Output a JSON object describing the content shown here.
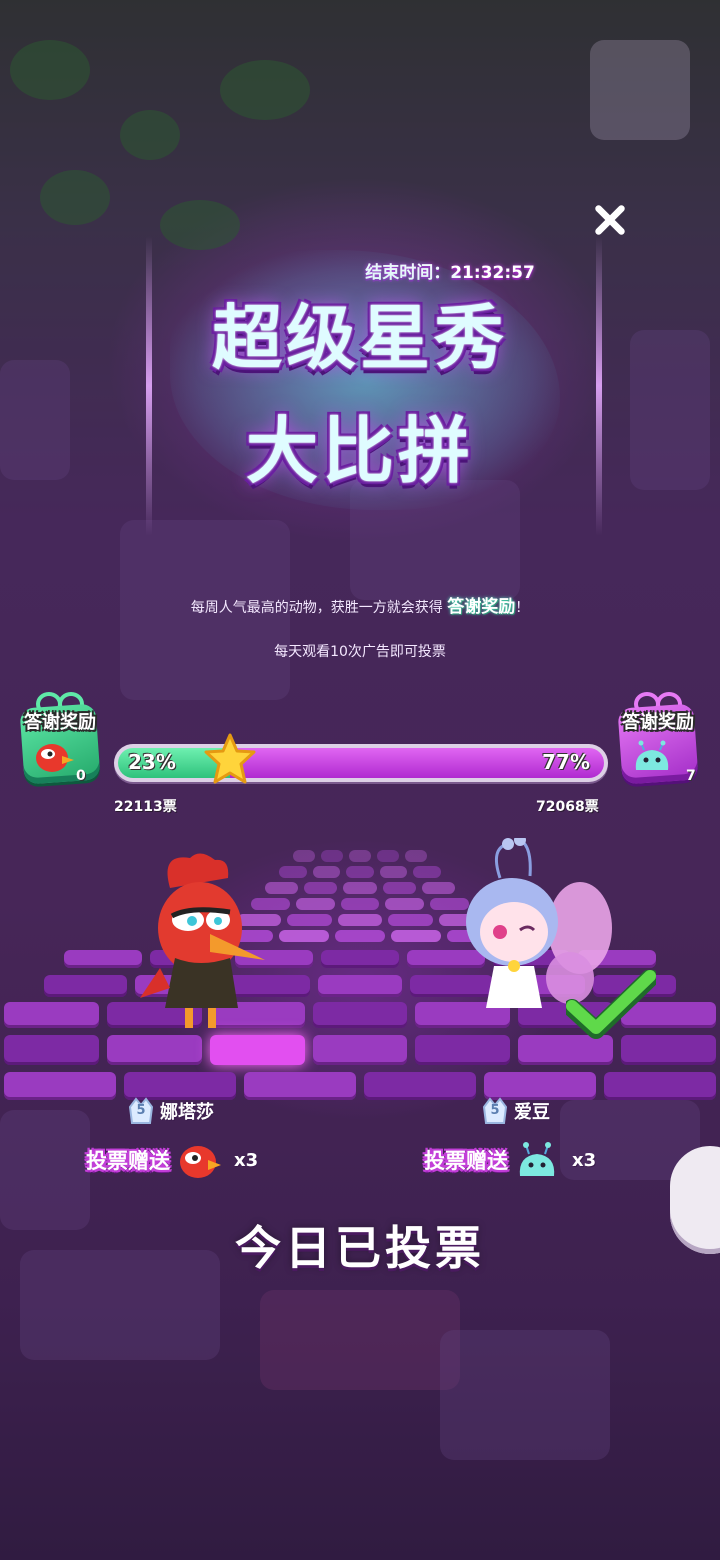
{
  "event": {
    "end_time_label": "结束时间：21:32:57",
    "title_line1": "超级星秀",
    "title_line2": "大比拼"
  },
  "description": {
    "line1_prefix": "每周人气最高的动物，获胜一方就会获得",
    "line1_highlight": "答谢奖励",
    "line1_suffix": "！",
    "line2": "每天观看10次广告即可投票"
  },
  "left_side": {
    "reward_label": "答谢奖励",
    "reward_count": "0",
    "percent": "23%",
    "percent_value": 23,
    "votes": "22113票",
    "level": "5",
    "name": "娜塔莎",
    "gift_label": "投票赠送",
    "gift_multiplier": "x3",
    "color": "#2fc27c"
  },
  "right_side": {
    "reward_label": "答谢奖励",
    "reward_count": "7",
    "percent": "77%",
    "percent_value": 77,
    "votes": "72068票",
    "level": "5",
    "name": "爱豆",
    "gift_label": "投票赠送",
    "gift_multiplier": "x3",
    "color": "#b02ad0",
    "voted_for": true
  },
  "status": {
    "voted_today": "今日已投票"
  },
  "icons": {
    "close": "close-icon",
    "star": "star-icon",
    "check": "check-icon",
    "left_item": "red-bird-icon",
    "right_item": "jelly-slime-icon"
  }
}
